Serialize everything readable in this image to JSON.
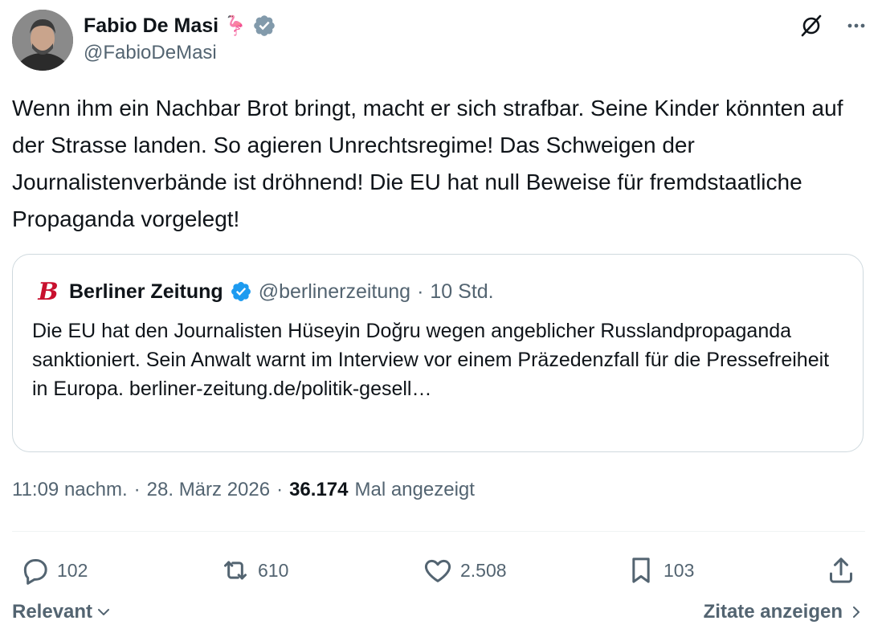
{
  "author": {
    "name": "Fabio De Masi",
    "emoji": "🦩",
    "handle": "@FabioDeMasi",
    "verified": true
  },
  "tweet": {
    "text": "Wenn ihm ein Nachbar Brot bringt, macht er sich strafbar. Seine Kinder könnten auf der Strasse landen. So agieren Unrechtsregime! Das Schweigen der Journalistenverbände ist dröhnend! Die EU hat null Beweise für fremdstaatliche Propaganda vorgelegt!"
  },
  "quote": {
    "logo_letter": "B",
    "name": "Berliner Zeitung",
    "handle": "@berlinerzeitung",
    "separator": "·",
    "time": "10 Std.",
    "text": "Die EU hat den Journalisten Hüseyin Doğru wegen angeblicher Russlandpropaganda sanktioniert. Sein Anwalt warnt im Interview vor einem Präzedenzfall für die Pressefreiheit in Europa. berliner-zeitung.de/politik-gesell…"
  },
  "meta": {
    "time": "11:09 nachm.",
    "sep": "·",
    "date": "28. März 2026",
    "views": "36.174",
    "views_label": "Mal angezeigt"
  },
  "actions": {
    "replies": "102",
    "reposts": "610",
    "likes": "2.508",
    "bookmarks": "103"
  },
  "bottom": {
    "sort_label": "Relevant",
    "quotes_label": "Zitate anzeigen"
  },
  "colors": {
    "text": "#0f1419",
    "secondary": "#536471",
    "verified": "#1d9bf0",
    "border": "#cfd9de",
    "berliner_red": "#c8102e"
  }
}
